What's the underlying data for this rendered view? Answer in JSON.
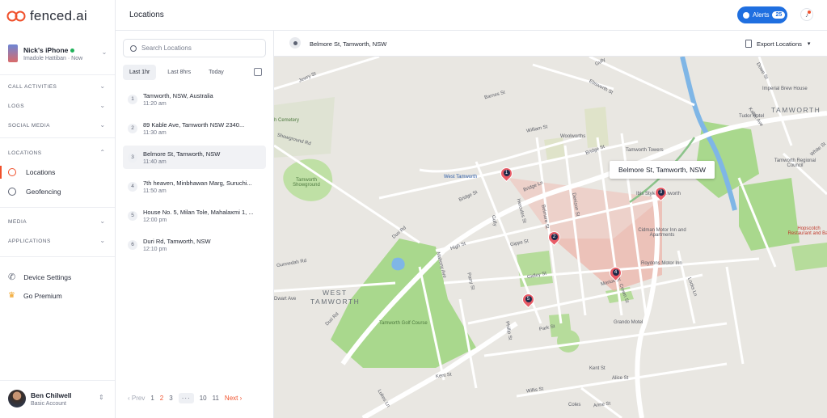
{
  "app": {
    "logo": "fenced.ai"
  },
  "device": {
    "name": "Nick's iPhone",
    "owner": "Imadole Hattiban",
    "status": "Now"
  },
  "nav": {
    "group1": [
      "CALL ACTIVITIES",
      "LOGS",
      "SOCIAL MEDIA"
    ],
    "locations": {
      "label": "LOCATIONS",
      "items": [
        "Locations",
        "Geofencing"
      ]
    },
    "group2": [
      "MEDIA",
      "APPLICATIONS"
    ],
    "bottom": [
      "Device Settings",
      "Go Premium"
    ]
  },
  "user": {
    "name": "Ben Chilwell",
    "plan": "Basic Account"
  },
  "header": {
    "title": "Locations",
    "alerts_label": "Alerts",
    "alerts_count": "25"
  },
  "search": {
    "placeholder": "Search Locations"
  },
  "tabs": [
    "Last 1hr",
    "Last 8hrs",
    "Today"
  ],
  "locations": [
    {
      "num": "1",
      "name": "Tamworth, NSW, Australia",
      "time": "11:20 am"
    },
    {
      "num": "2",
      "name": "89 Kable Ave, Tamworth NSW 2340...",
      "time": "11:30 am"
    },
    {
      "num": "3",
      "name": "Belmore St, Tamworth, NSW",
      "time": "11:40 am"
    },
    {
      "num": "4",
      "name": "7th heaven, Minbhawan Marg, Suruchi...",
      "time": "11:50 am"
    },
    {
      "num": "5",
      "name": "House No. 5, Milan Tole, Mahalaxmi 1, ...",
      "time": "12:00 pm"
    },
    {
      "num": "6",
      "name": "Duri Rd, Tamworth, NSW",
      "time": "12:10 pm"
    }
  ],
  "pager": {
    "prev": "Prev",
    "pages": [
      "1",
      "2",
      "3"
    ],
    "ellipsis": "···",
    "last_pages": [
      "10",
      "11"
    ],
    "next": "Next",
    "current": "2"
  },
  "map": {
    "header_title": "Belmore St, Tamworth, NSW",
    "export_label": "Export Locations",
    "tooltip": "Belmore St, Tamworth, NSW",
    "markers": [
      "1",
      "2",
      "3",
      "4",
      "5"
    ],
    "labels": {
      "tamworth": "TAMWORTH",
      "west_tamworth_1": "WEST",
      "west_tamworth_2": "TAMWORTH",
      "west_tamworth_station": "West Tamworth",
      "woolworths": "Woolworths",
      "tamworth_towers": "Tamworth Towers",
      "tudor_hotel": "Tudor Hotel",
      "imperial": "Imperial Brew House",
      "regional_council": "Tamworth Regional Council",
      "showground": "Tamworth Showground",
      "golf": "Tamworth Golf Course",
      "cidman": "Cidman Motor Inn and Apartments",
      "roydons": "Roydons Motor Inn",
      "grando": "Grando Motel",
      "hopscotch": "Hopscotch Restaurant and Bar",
      "coles": "Coles",
      "cemetery": "h Cemetery",
      "ibis": "Ibis Styles Tamworth",
      "streets": [
        "Jewry St",
        "Barnes St",
        "Ebsworth St",
        "William St",
        "Bridge St",
        "Bridge Ln",
        "Bridge St",
        "Showground Rd",
        "Duri Rd",
        "Hercules St",
        "Belmore St",
        "Denison St",
        "Kable Ave",
        "Dowe St",
        "White St",
        "High St",
        "Gipps St",
        "Mahony Ave",
        "Parry St",
        "Gidley St",
        "Marius St",
        "Crown St",
        "Darling St",
        "Park St",
        "Phillip St",
        "Kent St",
        "Alice St",
        "Willis St",
        "Anne St",
        "Dwart Ave",
        "Gunnedah Rd",
        "Lukes Ln",
        "Locks Ln",
        "Clift St",
        "Lindsay St",
        "King St",
        "Peel St",
        "Gully"
      ]
    }
  },
  "colors": {
    "accent": "#f0502b",
    "alerts": "#1f6fe0",
    "marker": "#e85b66",
    "park": "#b9dd9a",
    "water": "#7fb6e6"
  }
}
